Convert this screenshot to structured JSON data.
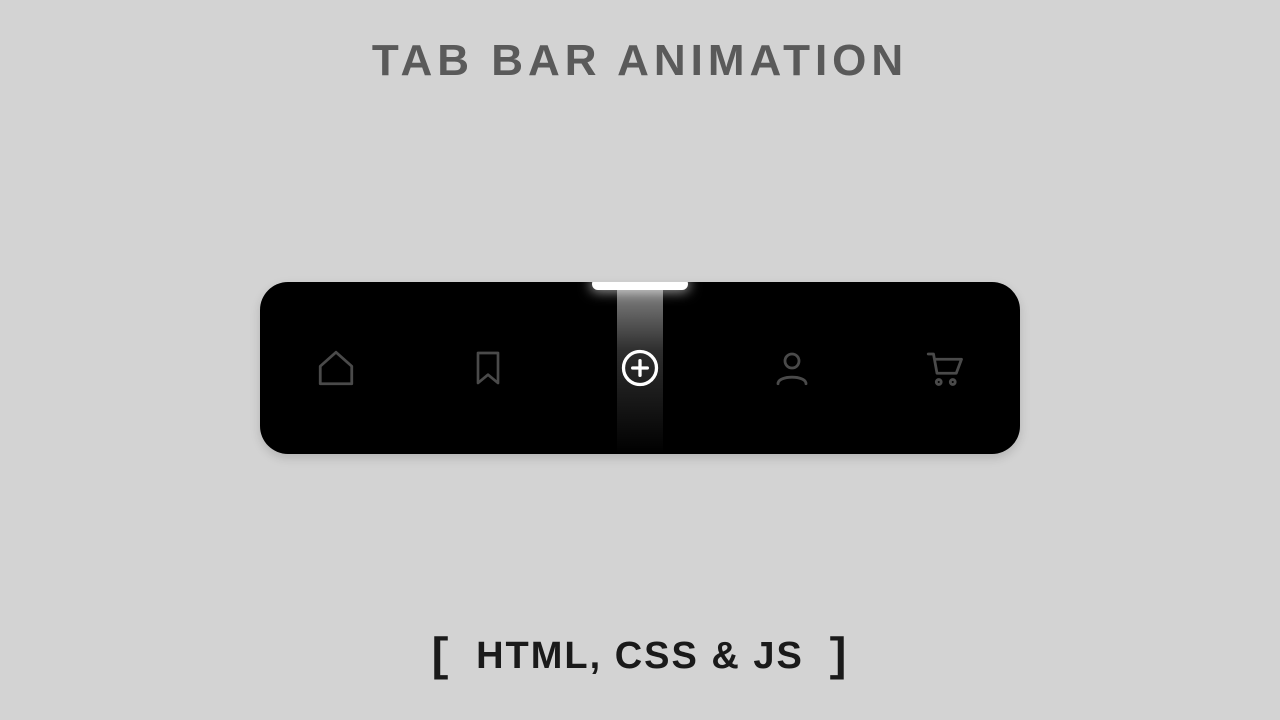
{
  "title": "TAB BAR  ANIMATION",
  "subtitle_inner": "HTML, CSS & JS",
  "colors": {
    "background": "#d3d3d3",
    "bar": "#000000",
    "icon_inactive": "#4a4a4a",
    "icon_active": "#ffffff",
    "title_text": "#5a5a5a",
    "subtitle_text": "#1a1a1a"
  },
  "tabbar": {
    "items": [
      {
        "icon": "home-icon",
        "label": "Home",
        "active": false
      },
      {
        "icon": "bookmark-icon",
        "label": "Bookmark",
        "active": false
      },
      {
        "icon": "plus-icon",
        "label": "Add",
        "active": true
      },
      {
        "icon": "user-icon",
        "label": "Profile",
        "active": false
      },
      {
        "icon": "cart-icon",
        "label": "Cart",
        "active": false
      }
    ]
  }
}
